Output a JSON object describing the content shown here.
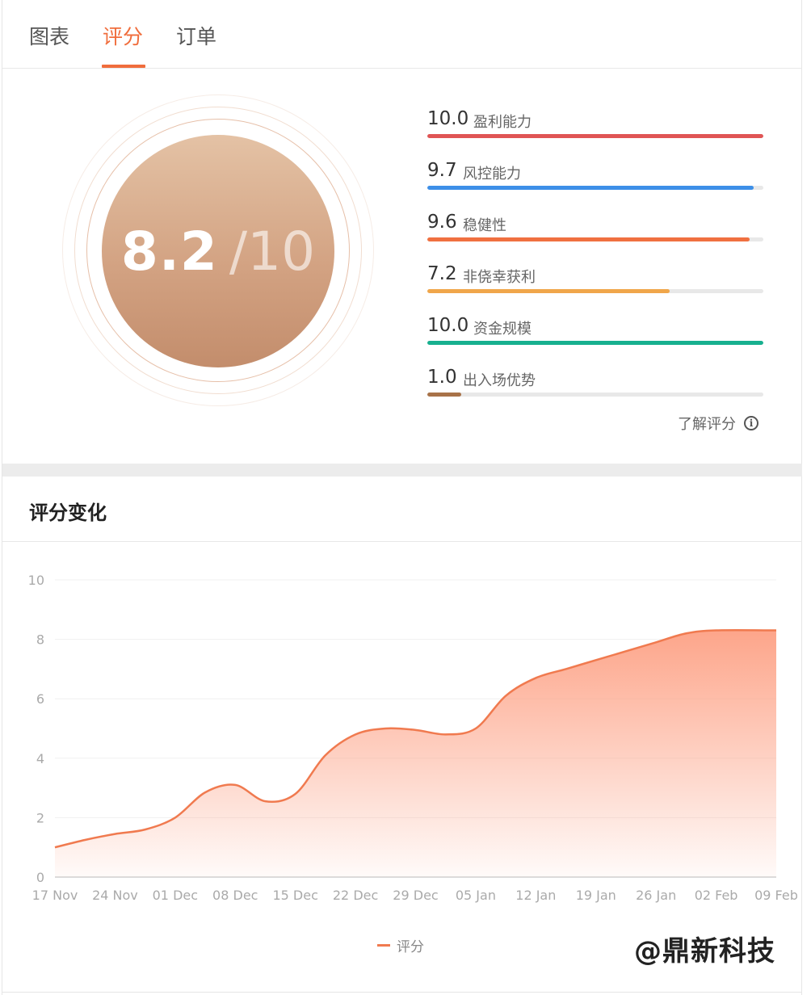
{
  "tabs": [
    {
      "label": "图表",
      "active": false
    },
    {
      "label": "评分",
      "active": true
    },
    {
      "label": "订单",
      "active": false
    }
  ],
  "score": {
    "value": "8.2",
    "max": "/10"
  },
  "metrics": [
    {
      "value": "10.0",
      "label": "盈利能力",
      "score": 10.0,
      "color": "#e05555"
    },
    {
      "value": "9.7",
      "label": "风控能力",
      "score": 9.7,
      "color": "#3d8fe8"
    },
    {
      "value": "9.6",
      "label": "稳健性",
      "score": 9.6,
      "color": "#f07040"
    },
    {
      "value": "7.2",
      "label": "非侥幸获利",
      "score": 7.2,
      "color": "#f0a64a"
    },
    {
      "value": "10.0",
      "label": "资金规模",
      "score": 10.0,
      "color": "#17b08f"
    },
    {
      "value": "1.0",
      "label": "出入场优势",
      "score": 1.0,
      "color": "#a87248"
    }
  ],
  "learn_more": "了解评分",
  "section_title": "评分变化",
  "legend_label": "评分",
  "watermark": "@鼎新科技",
  "colors": {
    "accent": "#f06d3c",
    "area_top": "#fda58a",
    "line": "#f07a4f"
  },
  "chart_data": {
    "type": "area",
    "x": [
      "17 Nov",
      "24 Nov",
      "01 Dec",
      "08 Dec",
      "15 Dec",
      "22 Dec",
      "29 Dec",
      "05 Jan",
      "12 Jan",
      "19 Jan",
      "26 Jan",
      "02 Feb",
      "09 Feb"
    ],
    "xlabel": "",
    "ylabel": "",
    "ylim": [
      0,
      10
    ],
    "yticks": [
      0,
      2,
      4,
      6,
      8,
      10
    ],
    "grid": true,
    "legend": "bottom-center",
    "series": [
      {
        "name": "评分",
        "points": [
          [
            0,
            1.0
          ],
          [
            0.5,
            1.25
          ],
          [
            1.0,
            1.45
          ],
          [
            1.5,
            1.6
          ],
          [
            2.0,
            2.0
          ],
          [
            2.5,
            2.85
          ],
          [
            3.0,
            3.1
          ],
          [
            3.5,
            2.55
          ],
          [
            4.0,
            2.8
          ],
          [
            4.5,
            4.1
          ],
          [
            5.0,
            4.8
          ],
          [
            5.5,
            5.0
          ],
          [
            6.0,
            4.95
          ],
          [
            6.5,
            4.8
          ],
          [
            7.0,
            5.0
          ],
          [
            7.5,
            6.1
          ],
          [
            8.0,
            6.7
          ],
          [
            8.5,
            7.0
          ],
          [
            9.0,
            7.3
          ],
          [
            9.5,
            7.6
          ],
          [
            10.0,
            7.9
          ],
          [
            10.5,
            8.2
          ],
          [
            11.0,
            8.3
          ],
          [
            12.0,
            8.3
          ]
        ]
      }
    ]
  }
}
